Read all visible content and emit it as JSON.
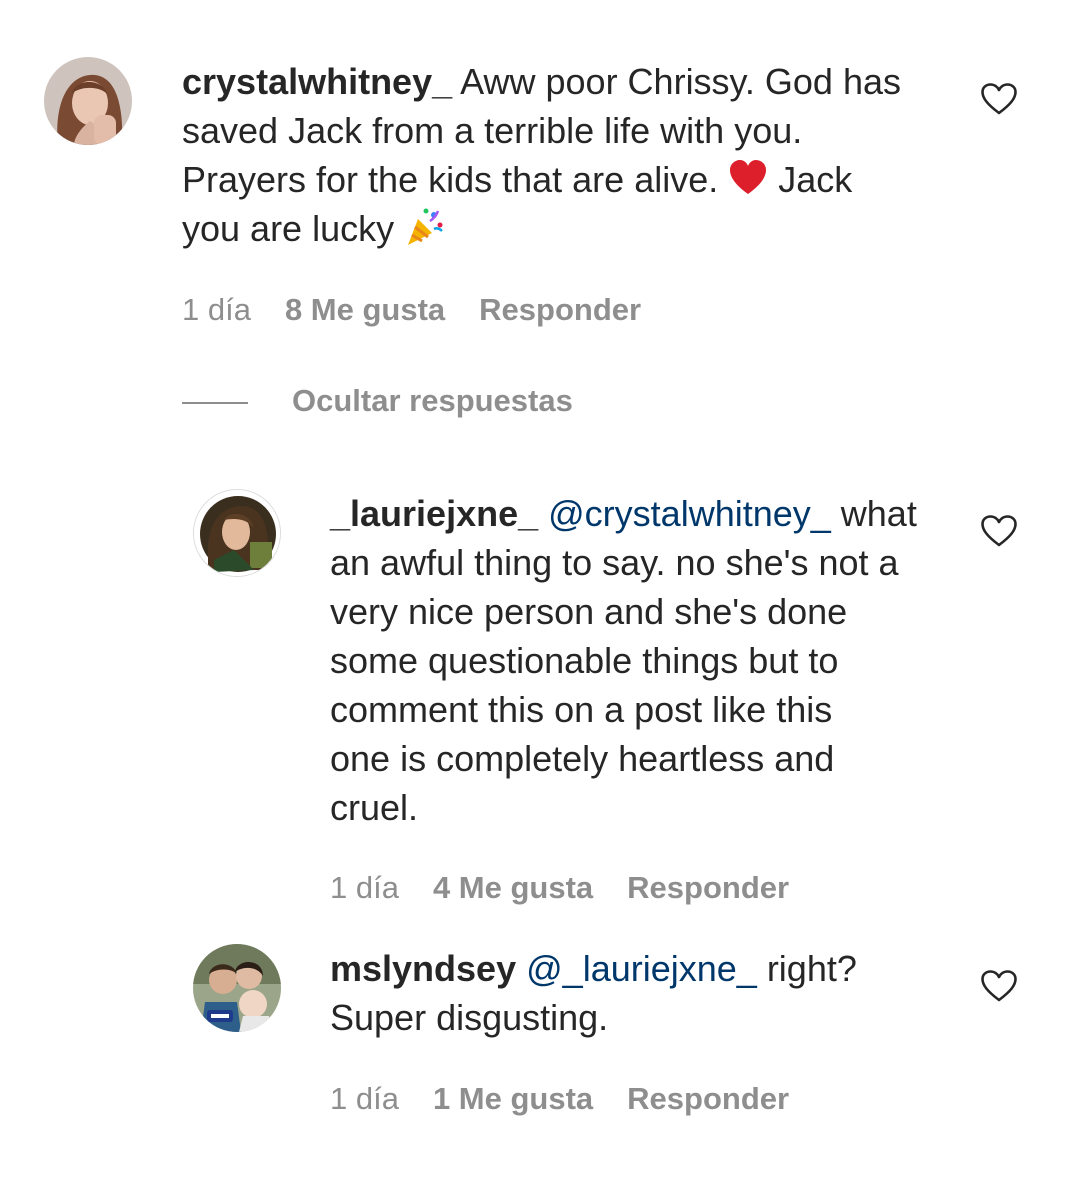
{
  "comments": [
    {
      "username": "crystalwhitney_",
      "text_lines": [
        " Aww poor Chrissy. God has",
        "saved Jack from a terrible life with you.",
        "Prayers for the kids that are alive. ",
        " Jack",
        "you are lucky "
      ],
      "emoji_names": [
        "red-heart-emoji",
        "party-popper-emoji"
      ],
      "time": "1 día",
      "likes": "8 Me gusta",
      "reply": "Responder"
    },
    {
      "username": "_lauriejxne_",
      "mention": "@crystalwhitney_",
      "text_lines": [
        " what",
        "an awful thing to say. no she's not a",
        "very nice person and she's done",
        "some questionable things but to",
        "comment this on a post like this",
        "one is completely heartless and",
        "cruel."
      ],
      "time": "1 día",
      "likes": "4 Me gusta",
      "reply": "Responder"
    },
    {
      "username": "mslyndsey",
      "mention": "@_lauriejxne_",
      "text_lines": [
        " right?",
        "Super disgusting."
      ],
      "time": "1 día",
      "likes": "1 Me gusta",
      "reply": "Responder"
    }
  ],
  "hide_replies_label": "Ocultar respuestas",
  "colors": {
    "text": "#262626",
    "secondary": "#8e8e8e",
    "mention": "#00376b",
    "background": "#ffffff"
  },
  "icons": {
    "like": "heart-outline-icon"
  }
}
